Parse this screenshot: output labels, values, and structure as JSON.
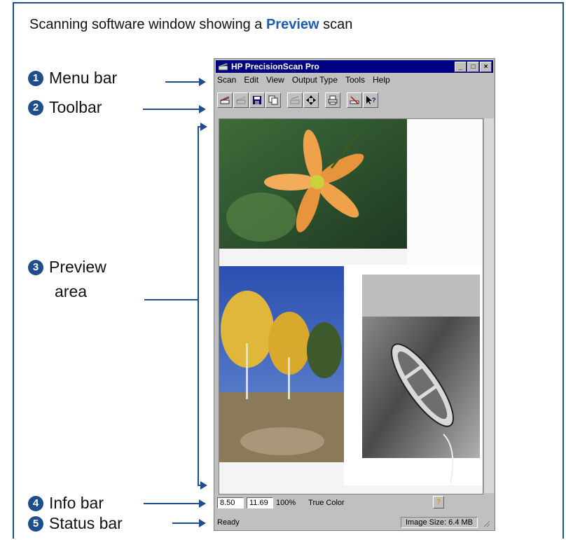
{
  "caption": {
    "prefix": "Scanning software window showing a ",
    "highlight": "Preview",
    "suffix": " scan"
  },
  "callouts": [
    {
      "num": "1",
      "label": "Menu bar"
    },
    {
      "num": "2",
      "label": "Toolbar"
    },
    {
      "num": "3",
      "label": "Preview",
      "label2": "area"
    },
    {
      "num": "4",
      "label": "Info bar"
    },
    {
      "num": "5",
      "label": "Status bar"
    }
  ],
  "window": {
    "title": "HP PrecisionScan Pro",
    "menus": [
      "Scan",
      "Edit",
      "View",
      "Output Type",
      "Tools",
      "Help"
    ],
    "toolbar_icons": [
      "scan-icon",
      "scan-disabled-icon",
      "save-icon",
      "copy-icon",
      "zoom-disabled-icon",
      "resize-icon",
      "print-icon",
      "clear-icon",
      "help-pointer-icon"
    ],
    "info": {
      "width": "8.50",
      "height": "11.69",
      "zoom": "100%",
      "output_type": "True Color"
    },
    "status": {
      "text": "Ready",
      "image_size": "Image Size: 6.4 MB"
    }
  },
  "colors": {
    "accent": "#1f4e8c",
    "titlebar": "#000080"
  }
}
